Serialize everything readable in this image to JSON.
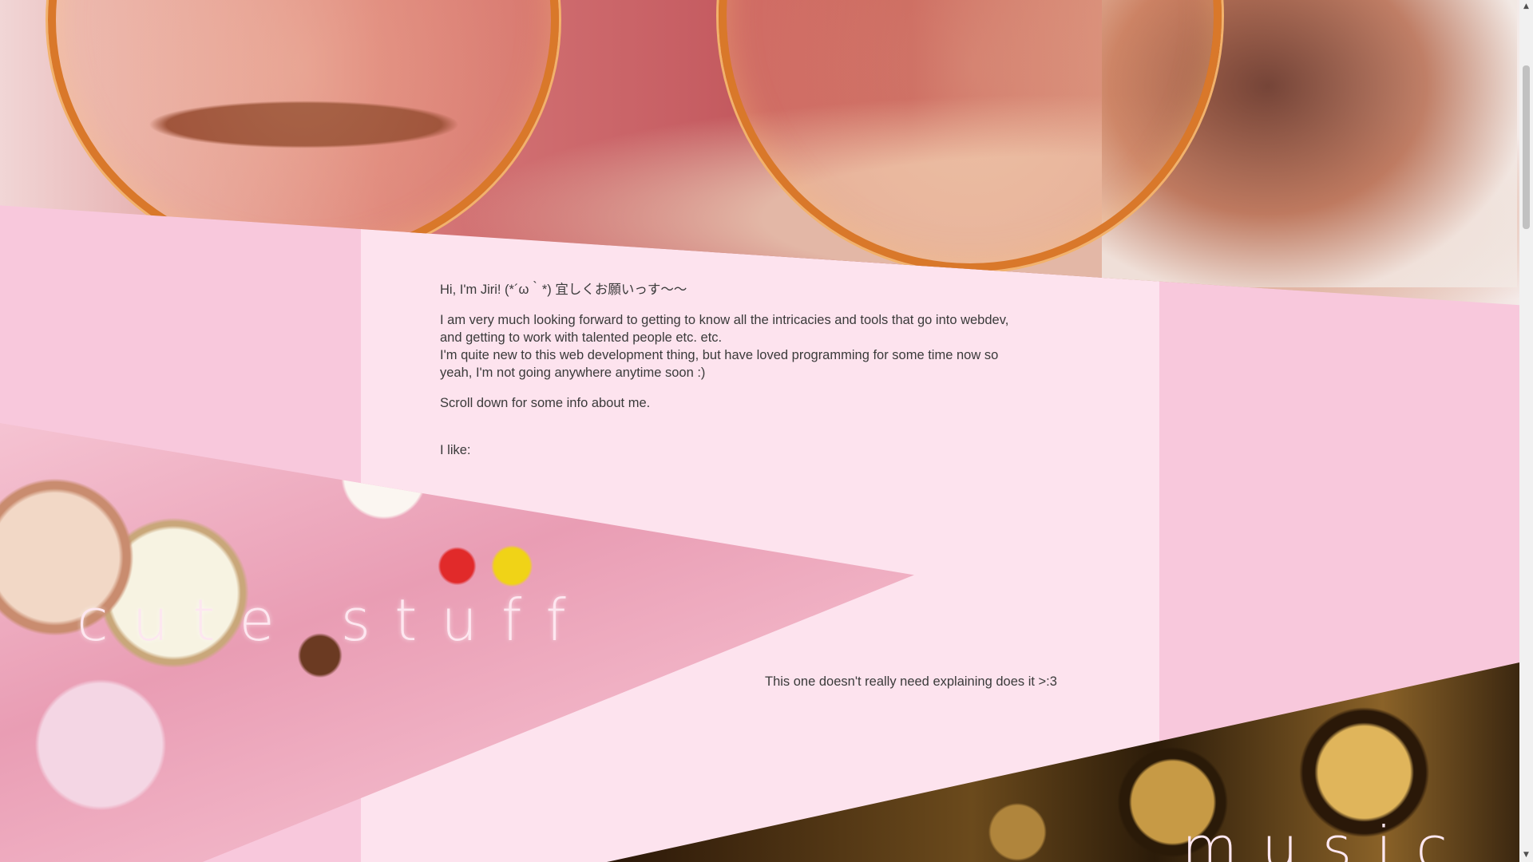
{
  "intro": {
    "greeting": "Hi, I'm Jiri! (*´ω｀*) 宜しくお願いっす〜〜",
    "para1_line1": "I am very much looking forward to getting to know all the intricacies and tools that go into webdev,",
    "para1_line2": "and getting to work with talented people etc. etc.",
    "para1_line3": "I'm quite new to this web development thing, but have loved programming for some time now so",
    "para1_line4": "yeah, I'm not going anywhere anytime soon :)",
    "scroll_hint": "Scroll down for some info about me."
  },
  "likes": {
    "label": "I like:",
    "items": [
      {
        "title": "cute stuff",
        "description": "This one doesn't really need explaining does it >:3"
      },
      {
        "title": "music",
        "description": ""
      }
    ]
  },
  "scrollbar": {
    "up_icon": "▲",
    "down_icon": "▼"
  },
  "colors": {
    "pink_bg": "#f8c8dc",
    "panel": "#fde3ee",
    "title_text": "#fde7f0"
  }
}
